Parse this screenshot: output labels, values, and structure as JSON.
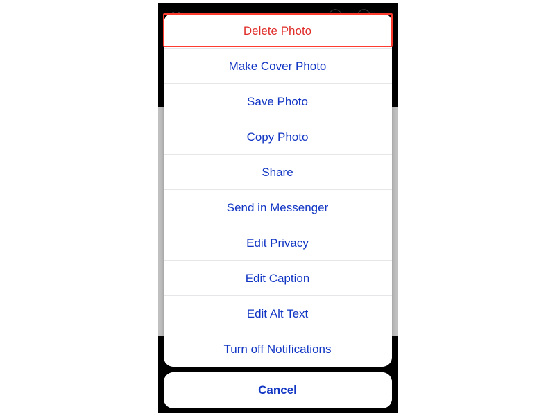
{
  "actionSheet": {
    "options": [
      {
        "label": "Delete Photo",
        "destructive": true,
        "highlighted": true,
        "name": "delete-photo-option"
      },
      {
        "label": "Make Cover Photo",
        "destructive": false,
        "highlighted": false,
        "name": "make-cover-photo-option"
      },
      {
        "label": "Save Photo",
        "destructive": false,
        "highlighted": false,
        "name": "save-photo-option"
      },
      {
        "label": "Copy Photo",
        "destructive": false,
        "highlighted": false,
        "name": "copy-photo-option"
      },
      {
        "label": "Share",
        "destructive": false,
        "highlighted": false,
        "name": "share-option"
      },
      {
        "label": "Send in Messenger",
        "destructive": false,
        "highlighted": false,
        "name": "send-in-messenger-option"
      },
      {
        "label": "Edit Privacy",
        "destructive": false,
        "highlighted": false,
        "name": "edit-privacy-option"
      },
      {
        "label": "Edit Caption",
        "destructive": false,
        "highlighted": false,
        "name": "edit-caption-option"
      },
      {
        "label": "Edit Alt Text",
        "destructive": false,
        "highlighted": false,
        "name": "edit-alt-text-option"
      },
      {
        "label": "Turn off Notifications",
        "destructive": false,
        "highlighted": false,
        "name": "turn-off-notifications-option"
      }
    ],
    "cancel_label": "Cancel"
  },
  "colors": {
    "action_blue": "#1236c4",
    "destructive_red": "#e02e2a",
    "highlight_border": "#ff3b2f"
  }
}
